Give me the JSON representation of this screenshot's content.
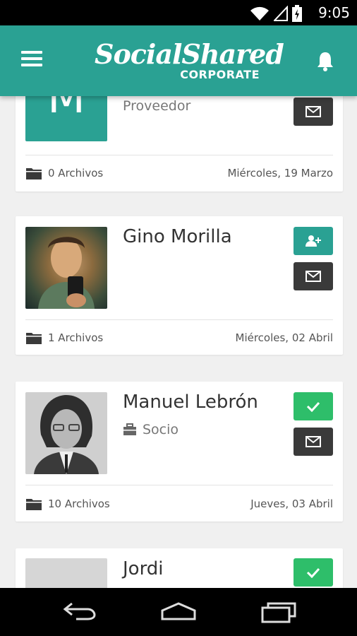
{
  "status_bar": {
    "time": "9:05"
  },
  "app_bar": {
    "logo_main": "SocialShared",
    "logo_sub": "CORPORATE"
  },
  "cards": [
    {
      "initial": "M",
      "role": "Proveedor",
      "files": "0 Archivos",
      "date": "Miércoles, 19 Marzo"
    },
    {
      "name": "Gino Morilla",
      "files": "1 Archivos",
      "date": "Miércoles, 02 Abril"
    },
    {
      "name": "Manuel Lebrón",
      "role": "Socio",
      "files": "10 Archivos",
      "date": "Jueves, 03 Abril"
    },
    {
      "name": "Jordi"
    }
  ],
  "colors": {
    "teal": "#2aa193",
    "green": "#2ebe6a",
    "dark_button": "#3a3a3a",
    "background": "#f0f0f0"
  },
  "icons": [
    "wifi-icon",
    "signal-icon",
    "battery-icon",
    "menu-icon",
    "bell-icon",
    "mail-icon",
    "add-contact-icon",
    "check-icon",
    "folder-icon",
    "briefcase-icon",
    "back-icon",
    "home-icon",
    "recent-apps-icon"
  ]
}
